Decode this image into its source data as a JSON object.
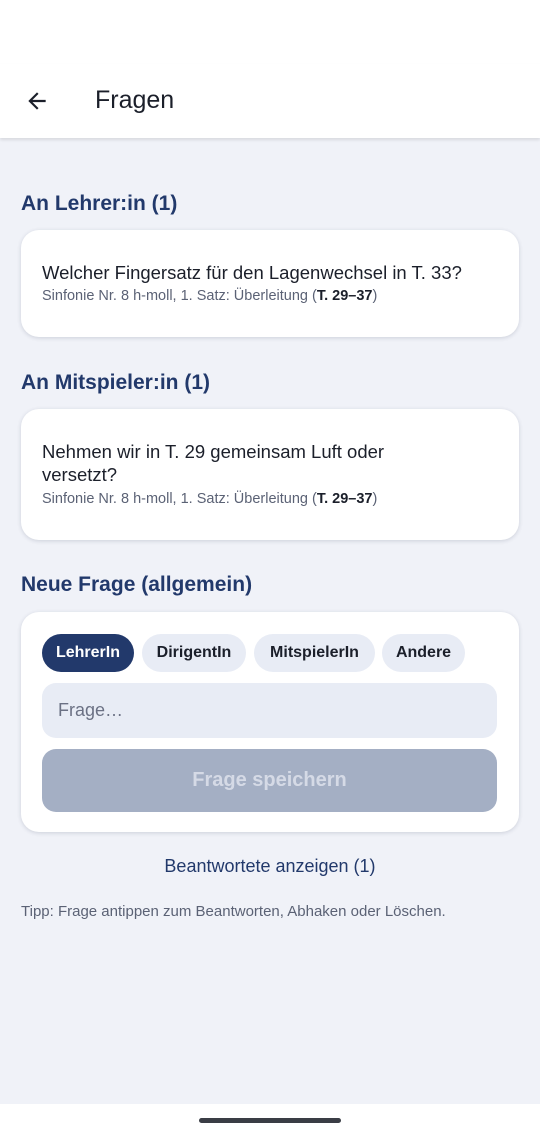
{
  "header": {
    "title": "Fragen"
  },
  "sections": {
    "teacher": {
      "heading": "An Lehrer:in (1)",
      "question": "Welcher Fingersatz für den Lagenwechsel in T. 33?",
      "meta_prefix": "Sinfonie Nr. 8 h-moll, 1. Satz: Überleitung (",
      "meta_bars": "T. 29–37",
      "meta_suffix": ")"
    },
    "fellow": {
      "heading": "An Mitspieler:in (1)",
      "question": "Nehmen wir in T. 29 gemeinsam Luft oder versetzt?",
      "meta_prefix": "Sinfonie Nr. 8 h-moll, 1. Satz: Überleitung (",
      "meta_bars": "T. 29–37",
      "meta_suffix": ")"
    },
    "new_question": {
      "heading": "Neue Frage (allgemein)",
      "chips": [
        "LehrerIn",
        "DirigentIn",
        "MitspielerIn",
        "Andere"
      ],
      "selected_chip": "LehrerIn",
      "input_placeholder": "Frage…",
      "input_value": "",
      "save_label": "Frage speichern"
    }
  },
  "answered_link": "Beantwortete anzeigen (1)",
  "tip": "Tipp: Frage antippen zum Beantworten, Abhaken oder Löschen.",
  "icons": {
    "back": "arrow-left-icon"
  },
  "colors": {
    "accent": "#22396b",
    "background": "#f0f2f8",
    "chip_bg": "#e8ecf5",
    "disabled_button": "#a4afc4"
  }
}
